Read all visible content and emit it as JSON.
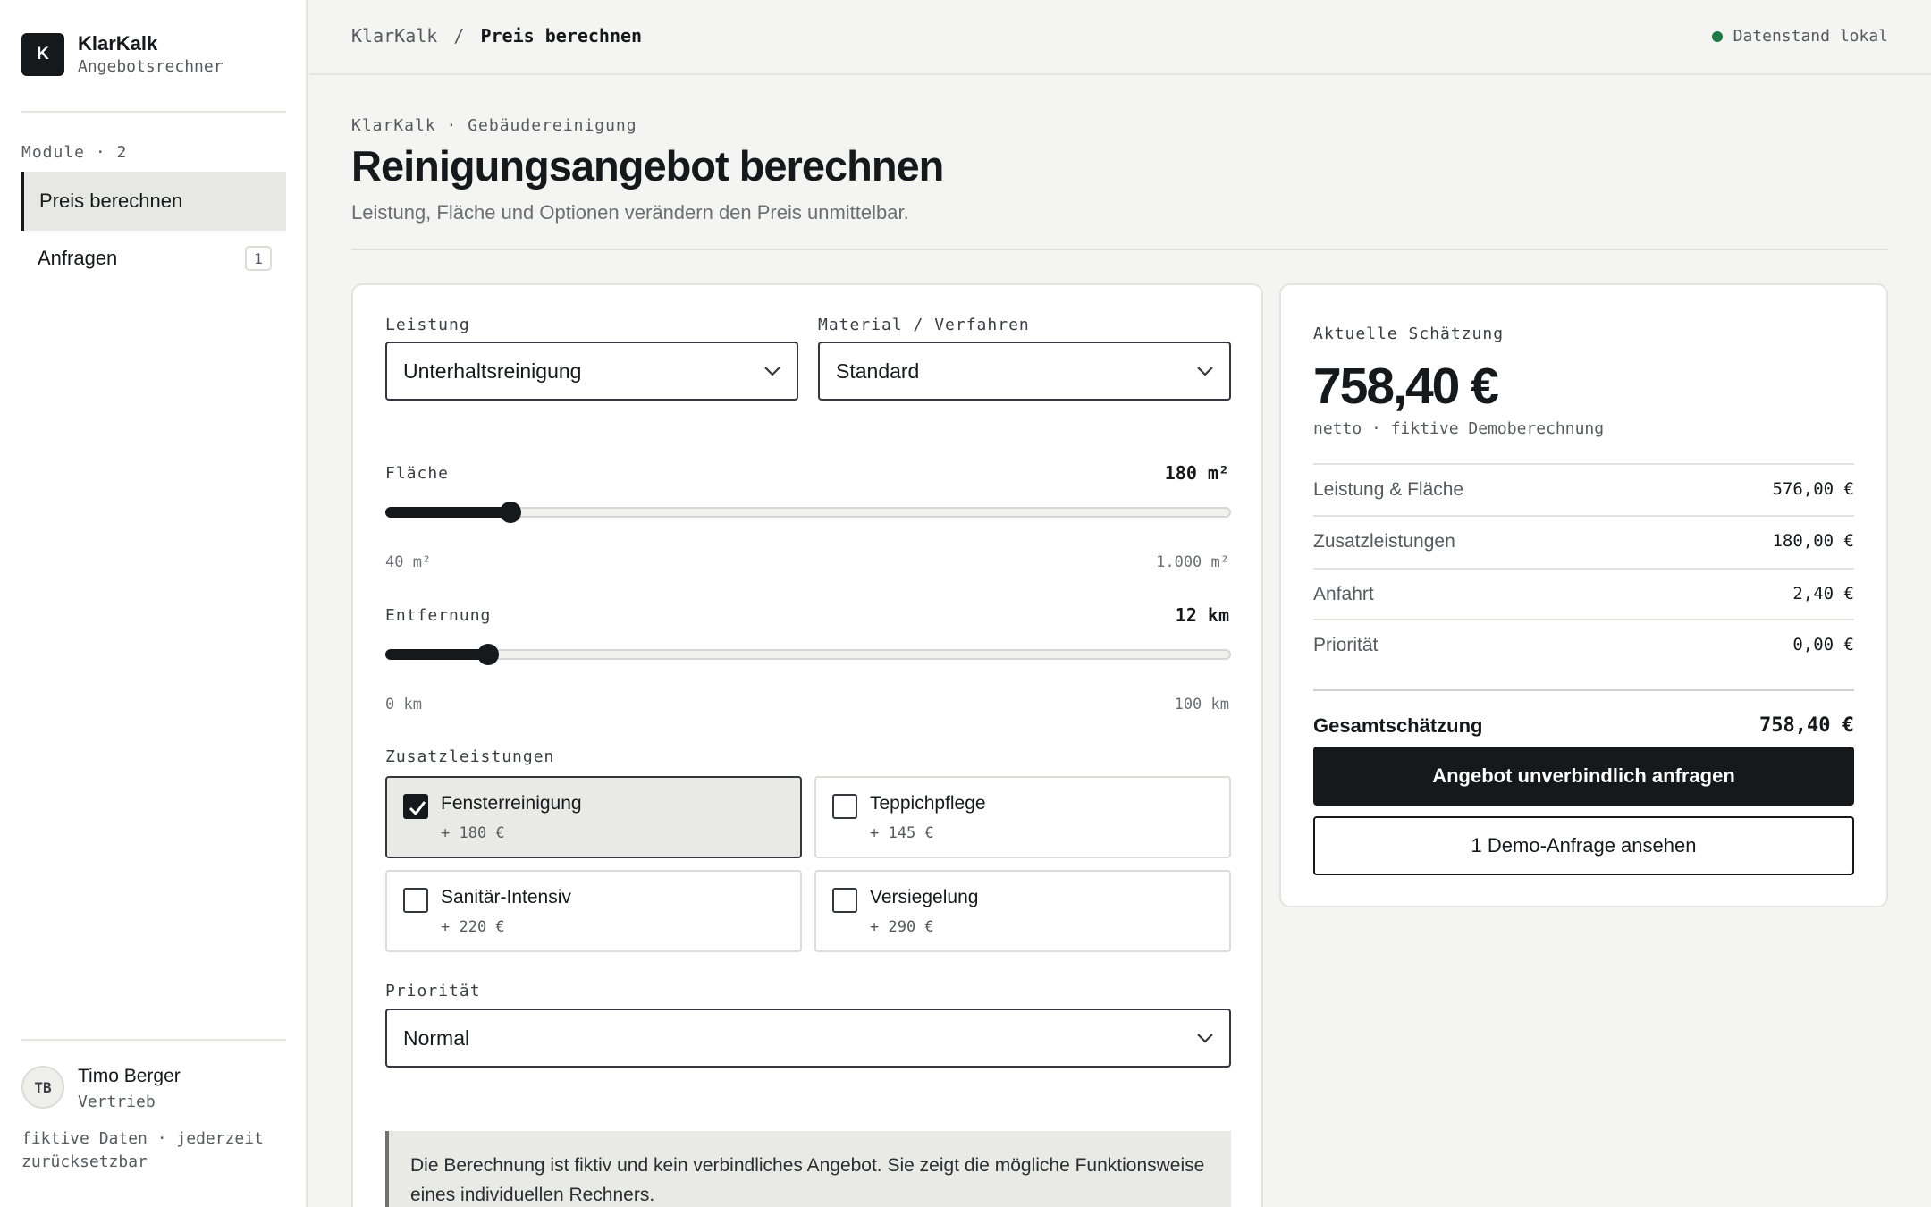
{
  "app": {
    "logo_letter": "K",
    "name": "KlarKalk",
    "subtitle": "Angebotsrechner"
  },
  "sidebar": {
    "modules_label": "Module · 2",
    "items": [
      {
        "label": "Preis berechnen",
        "active": true
      },
      {
        "label": "Anfragen",
        "badge": "1"
      }
    ],
    "user": {
      "initials": "TB",
      "name": "Timo Berger",
      "role": "Vertrieb"
    },
    "footnote": "fiktive Daten · jederzeit zurücksetzbar"
  },
  "topbar": {
    "breadcrumb_root": "KlarKalk",
    "breadcrumb_sep": "/",
    "breadcrumb_current": "Preis berechnen",
    "status": "Datenstand lokal",
    "status_color": "#1f7a45"
  },
  "header": {
    "eyebrow": "KlarKalk · Gebäudereinigung",
    "title": "Reinigungsangebot berechnen",
    "subtitle": "Leistung, Fläche und Optionen verändern den Preis unmittelbar."
  },
  "form": {
    "service": {
      "label": "Leistung",
      "value": "Unterhaltsreinigung"
    },
    "material": {
      "label": "Material / Verfahren",
      "value": "Standard"
    },
    "area": {
      "label": "Fläche",
      "value": "180 m²",
      "min_label": "40 m²",
      "max_label": "1.000 m²",
      "fraction": 0.146
    },
    "distance": {
      "label": "Entfernung",
      "value": "12 km",
      "min_label": "0 km",
      "max_label": "100 km",
      "fraction": 0.12
    },
    "extras": {
      "label": "Zusatzleistungen",
      "options": [
        {
          "name": "Fensterreinigung",
          "price": "+ 180 €",
          "checked": true
        },
        {
          "name": "Teppichpflege",
          "price": "+ 145 €",
          "checked": false
        },
        {
          "name": "Sanitär-Intensiv",
          "price": "+ 220 €",
          "checked": false
        },
        {
          "name": "Versiegelung",
          "price": "+ 290 €",
          "checked": false
        }
      ]
    },
    "priority": {
      "label": "Priorität",
      "value": "Normal"
    },
    "note": "Die Berechnung ist fiktiv und kein verbindliches Angebot. Sie zeigt die mögliche Funktionsweise eines individuellen Rechners."
  },
  "estimate": {
    "label": "Aktuelle Schätzung",
    "price": "758,40 €",
    "note": "netto · fiktive Demoberechnung",
    "breakdown": [
      {
        "label": "Leistung & Fläche",
        "value": "576,00 €"
      },
      {
        "label": "Zusatzleistungen",
        "value": "180,00 €"
      },
      {
        "label": "Anfahrt",
        "value": "2,40 €"
      },
      {
        "label": "Priorität",
        "value": "0,00 €"
      }
    ],
    "total_label": "Gesamtschätzung",
    "total_value": "758,40 €",
    "primary_button": "Angebot unverbindlich anfragen",
    "secondary_button": "1 Demo-Anfrage ansehen"
  }
}
